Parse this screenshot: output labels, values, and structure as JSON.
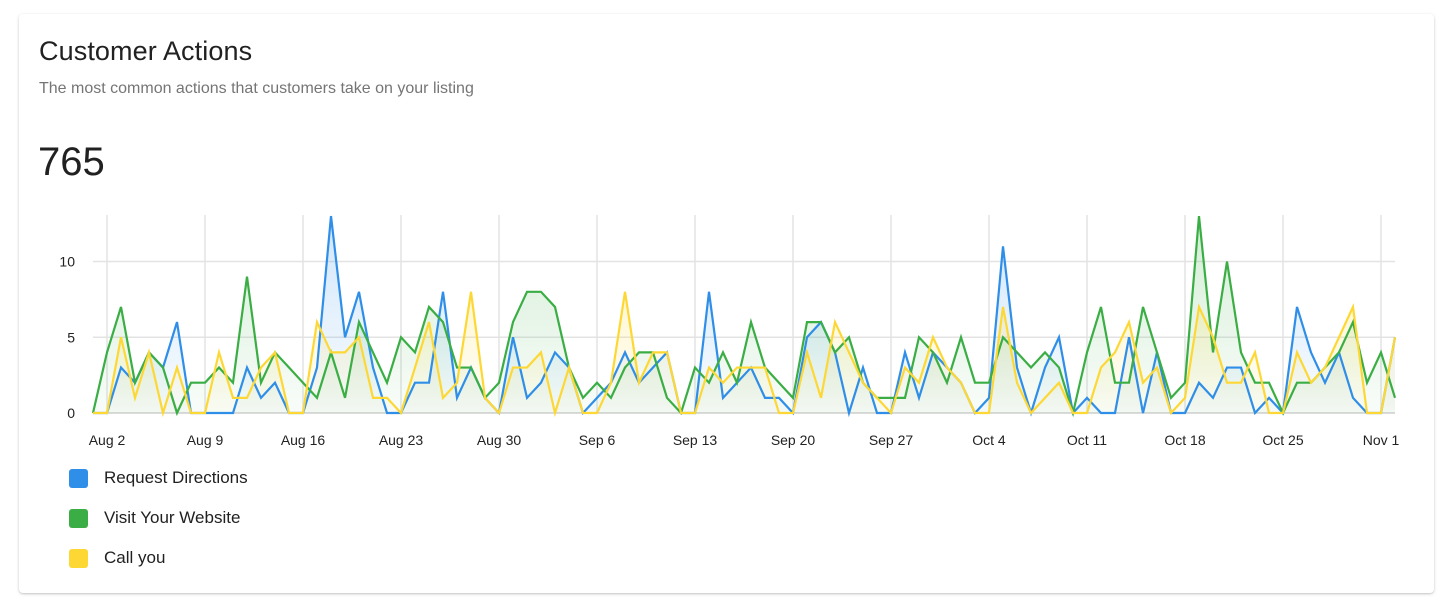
{
  "card": {
    "title": "Customer Actions",
    "subtitle": "The most common actions that customers take on your listing",
    "total": "765"
  },
  "chart_data": {
    "type": "line",
    "title": "Customer Actions",
    "xlabel": "",
    "ylabel": "",
    "ylim": [
      0,
      13
    ],
    "yticks": [
      0,
      5,
      10
    ],
    "grid": true,
    "legend_position": "bottom-left",
    "x_start": "Aug 1",
    "x_end": "Nov 2",
    "xtick_labels": [
      "Aug 2",
      "Aug 9",
      "Aug 16",
      "Aug 23",
      "Aug 30",
      "Sep 6",
      "Sep 13",
      "Sep 20",
      "Sep 27",
      "Oct 4",
      "Oct 11",
      "Oct 18",
      "Oct 25",
      "Nov 1"
    ],
    "xtick_day_index": [
      1,
      8,
      15,
      22,
      29,
      36,
      43,
      50,
      57,
      64,
      71,
      78,
      85,
      92
    ],
    "series": [
      {
        "name": "Request Directions",
        "color": "#2f8ee8",
        "values": [
          0,
          0,
          3,
          2,
          4,
          3,
          6,
          0,
          0,
          0,
          0,
          3,
          1,
          2,
          0,
          0,
          3,
          13,
          5,
          8,
          3,
          0,
          0,
          2,
          2,
          8,
          1,
          3,
          1,
          0,
          5,
          1,
          2,
          4,
          3,
          0,
          1,
          2,
          4,
          2,
          3,
          4,
          0,
          0,
          8,
          1,
          2,
          3,
          1,
          1,
          0,
          5,
          6,
          4,
          0,
          3,
          0,
          0,
          4,
          1,
          4,
          3,
          2,
          0,
          1,
          11,
          3,
          0,
          3,
          5,
          0,
          1,
          0,
          0,
          5,
          0,
          4,
          0,
          0,
          2,
          1,
          3,
          3,
          0,
          1,
          0,
          7,
          4,
          2,
          4,
          1,
          0,
          0,
          5
        ]
      },
      {
        "name": "Visit Your Website",
        "color": "#3aae44",
        "values": [
          0,
          4,
          7,
          2,
          4,
          3,
          0,
          2,
          2,
          3,
          2,
          9,
          2,
          4,
          3,
          2,
          1,
          4,
          1,
          6,
          4,
          2,
          5,
          4,
          7,
          6,
          3,
          3,
          1,
          2,
          6,
          8,
          8,
          7,
          3,
          1,
          2,
          1,
          3,
          4,
          4,
          1,
          0,
          3,
          2,
          4,
          2,
          6,
          3,
          2,
          1,
          6,
          6,
          4,
          5,
          2,
          1,
          1,
          1,
          5,
          4,
          2,
          5,
          2,
          2,
          5,
          4,
          3,
          4,
          3,
          0,
          4,
          7,
          2,
          2,
          7,
          4,
          1,
          2,
          13,
          4,
          10,
          4,
          2,
          2,
          0,
          2,
          2,
          3,
          4,
          6,
          2,
          4,
          1
        ]
      },
      {
        "name": "Call you",
        "color": "#fdd835",
        "values": [
          0,
          0,
          5,
          1,
          4,
          0,
          3,
          0,
          0,
          4,
          1,
          1,
          3,
          4,
          0,
          0,
          6,
          4,
          4,
          5,
          1,
          1,
          0,
          3,
          6,
          1,
          2,
          8,
          1,
          0,
          3,
          3,
          4,
          0,
          3,
          0,
          0,
          2,
          8,
          2,
          4,
          4,
          0,
          0,
          3,
          2,
          3,
          3,
          3,
          0,
          0,
          4,
          1,
          6,
          4,
          2,
          1,
          0,
          3,
          2,
          5,
          3,
          2,
          0,
          0,
          7,
          2,
          0,
          1,
          2,
          0,
          0,
          3,
          4,
          6,
          2,
          3,
          0,
          1,
          7,
          5,
          2,
          2,
          4,
          0,
          0,
          4,
          2,
          3,
          5,
          7,
          0,
          0,
          5
        ]
      }
    ]
  },
  "legend": [
    {
      "label": "Request Directions",
      "color": "#2f8ee8"
    },
    {
      "label": "Visit Your Website",
      "color": "#3aae44"
    },
    {
      "label": "Call you",
      "color": "#fdd835"
    }
  ]
}
